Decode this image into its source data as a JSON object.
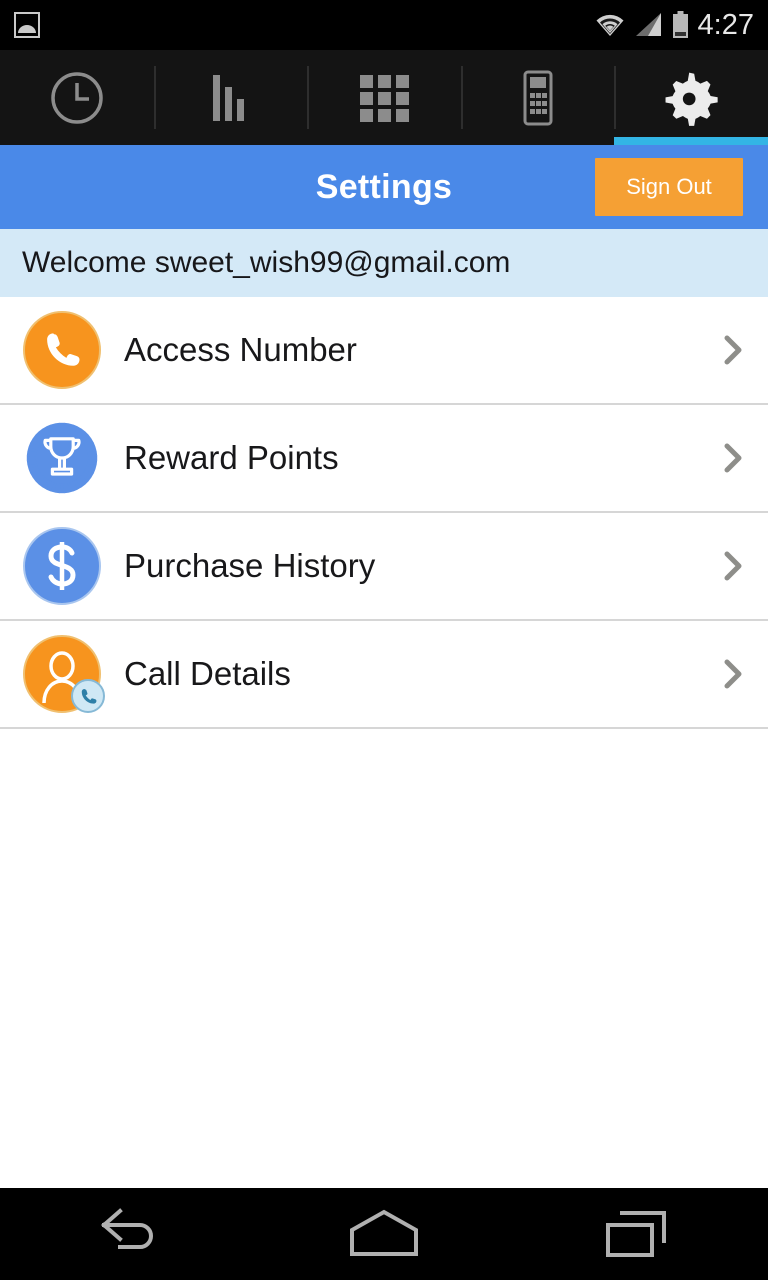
{
  "status_bar": {
    "notification_icon": "photo-icon",
    "icons": [
      "wifi-icon",
      "cellular-signal-icon",
      "battery-icon"
    ],
    "time": "4:27"
  },
  "tab_bar": {
    "active_index": 4,
    "accent_color": "#33b5e5",
    "tabs": [
      {
        "name": "recent",
        "icon": "clock-icon"
      },
      {
        "name": "stats",
        "icon": "bar-chart-icon"
      },
      {
        "name": "contacts",
        "icon": "grid-apps-icon"
      },
      {
        "name": "dialer",
        "icon": "phone-keypad-icon"
      },
      {
        "name": "settings",
        "icon": "gear-icon"
      }
    ]
  },
  "header": {
    "title": "Settings",
    "background_color": "#4a89e8",
    "sign_out_label": "Sign Out",
    "sign_out_color": "#f5a034"
  },
  "welcome": {
    "text": "Welcome sweet_wish99@gmail.com",
    "background_color": "#d4e9f7"
  },
  "list": {
    "items": [
      {
        "label": "Access Number",
        "icon": "phone-handset-icon",
        "icon_style": "circle-orange",
        "chevron": "chevron-right-icon"
      },
      {
        "label": "Reward Points",
        "icon": "trophy-badge-icon",
        "icon_style": "starburst-blue",
        "chevron": "chevron-right-icon"
      },
      {
        "label": "Purchase History",
        "icon": "dollar-sign-icon",
        "icon_style": "circle-blue",
        "chevron": "chevron-right-icon"
      },
      {
        "label": "Call Details",
        "icon": "person-phone-icon",
        "icon_style": "circle-orange",
        "chevron": "chevron-right-icon"
      }
    ]
  },
  "nav_bar": {
    "buttons": [
      {
        "name": "back",
        "icon": "back-arrow-icon"
      },
      {
        "name": "home",
        "icon": "home-icon"
      },
      {
        "name": "recents",
        "icon": "recent-apps-icon"
      }
    ]
  }
}
